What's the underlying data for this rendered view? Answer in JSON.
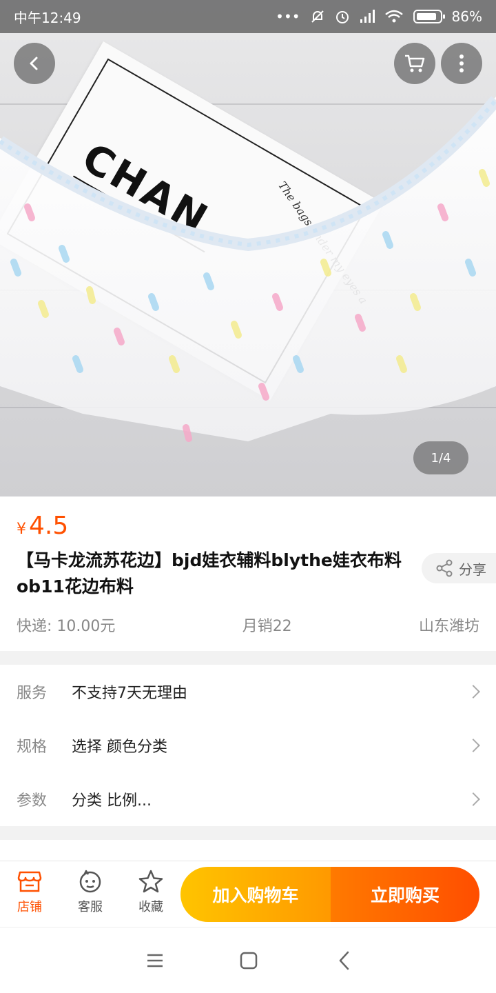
{
  "status_bar": {
    "time": "中午12:49",
    "battery": "86%"
  },
  "hero": {
    "page_indicator": "1/4",
    "card_brand": "CHAN",
    "card_tagline": "The bags under my eyes a"
  },
  "product": {
    "currency_symbol": "¥",
    "price": "4.5",
    "title": "【马卡龙流苏花边】bjd娃衣辅料blythe娃衣布料ob11花边布料",
    "share_label": "分享",
    "shipping": "快递: 10.00元",
    "monthly_sales": "月销22",
    "location": "山东潍坊"
  },
  "options": [
    {
      "label": "服务",
      "value": "不支持7天无理由"
    },
    {
      "label": "规格",
      "value": "选择 颜色分类"
    },
    {
      "label": "参数",
      "value": "分类 比例..."
    }
  ],
  "bottom_bar": {
    "store_label": "店铺",
    "service_label": "客服",
    "favorite_label": "收藏",
    "add_to_cart_label": "加入购物车",
    "buy_now_label": "立即购买"
  },
  "colors": {
    "accent": "#ff5000",
    "cart_gradient_start": "#ffc400",
    "buy_gradient_end": "#ff4e00"
  },
  "icons": [
    "back-arrow-icon",
    "cart-icon",
    "more-vertical-icon",
    "share-icon",
    "store-icon",
    "customer-service-icon",
    "star-icon",
    "chevron-right-icon"
  ]
}
